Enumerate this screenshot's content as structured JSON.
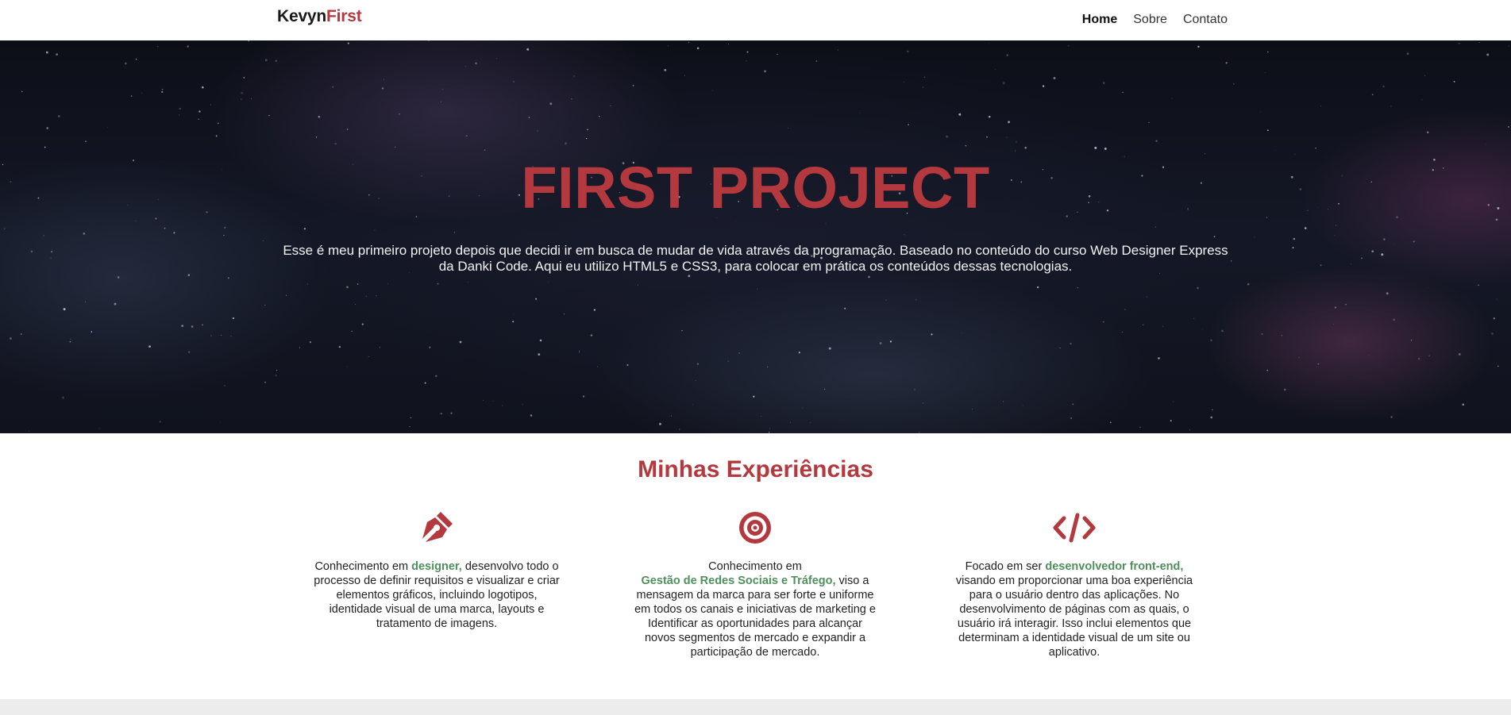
{
  "header": {
    "logo_main": "Kevyn",
    "logo_accent": "First",
    "nav": [
      "Home",
      "Sobre",
      "Contato"
    ]
  },
  "hero": {
    "title": "FIRST PROJECT",
    "description": "Esse é meu primeiro projeto depois que decidi ir em busca de mudar de vida através da programação. Baseado no conteúdo do curso Web Designer Express da Danki Code. Aqui eu utilizo HTML5 e CSS3, para colocar em prática os conteúdos dessas tecnologias."
  },
  "experiences": {
    "title": "Minhas Experiências",
    "cards": [
      {
        "icon": "pen-nib-icon",
        "pre": "Conhecimento em ",
        "highlight": "designer,",
        "post": " desenvolvo todo o processo de definir requisitos e visualizar e criar elementos gráficos, incluindo logotipos, identidade visual de uma marca, layouts e tratamento de imagens."
      },
      {
        "icon": "bullseye-icon",
        "pre": "Conhecimento em",
        "highlight": "Gestão de Redes Sociais e Tráfego,",
        "post": " viso a mensagem da marca para ser forte e uniforme em todos os canais e iniciativas de marketing e Identificar as oportunidades para alcançar novos segmentos de mercado e expandir a participação de mercado."
      },
      {
        "icon": "code-icon",
        "pre": "Focado em ser ",
        "highlight": "desenvolvedor front-end,",
        "post": " visando em proporcionar uma boa experiência para o usuário dentro das aplicações. No desenvolvimento de páginas com as quais, o usuário irá interagir. Isso inclui elementos que determinam a identidade visual de um site ou aplicativo."
      }
    ]
  },
  "colors": {
    "accent": "#b4393e",
    "highlight": "#4f8f5c"
  }
}
